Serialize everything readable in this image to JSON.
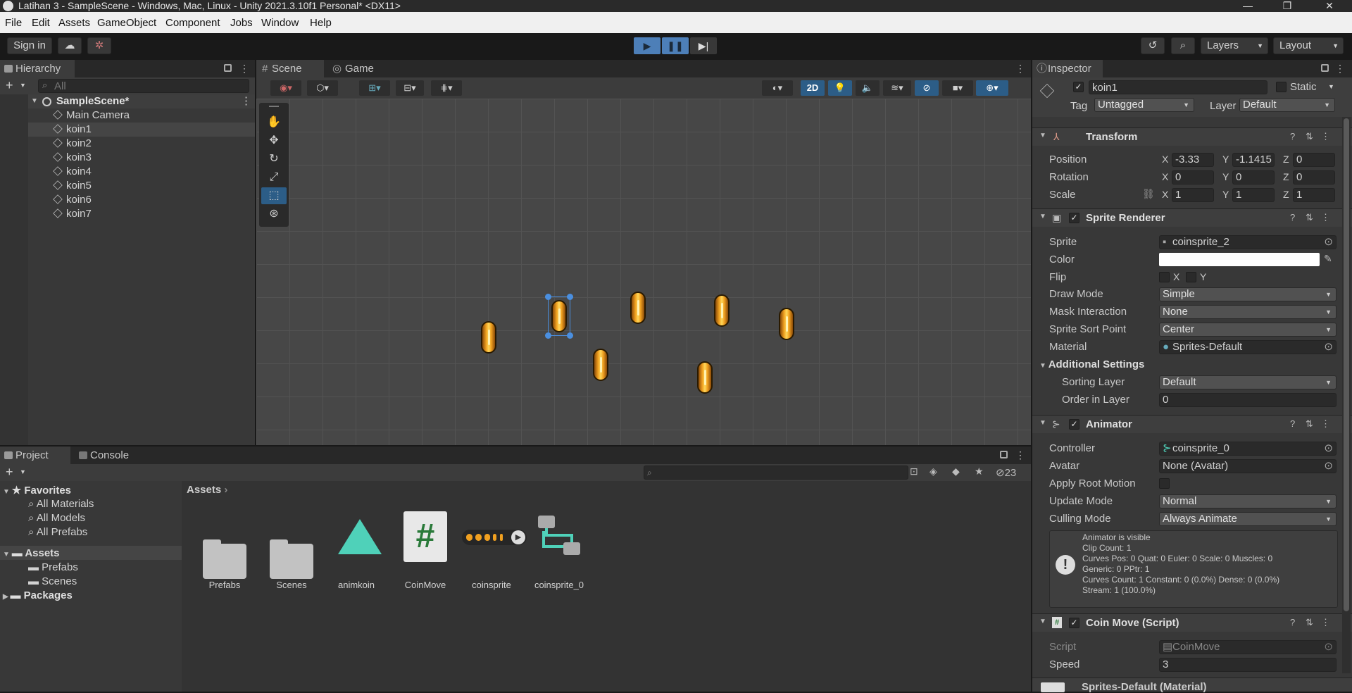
{
  "window": {
    "title": "Latihan 3 - SampleScene - Windows, Mac, Linux - Unity 2021.3.10f1 Personal* <DX11>",
    "controls": [
      "—",
      "❐",
      "✕"
    ]
  },
  "menu": [
    "File",
    "Edit",
    "Assets",
    "GameObject",
    "Component",
    "Jobs",
    "Window",
    "Help"
  ],
  "toolbar": {
    "sign_in": "Sign in",
    "layers": "Layers",
    "layout": "Layout"
  },
  "hierarchy": {
    "tab": "Hierarchy",
    "search_placeholder": "All",
    "scene": "SampleScene*",
    "items": [
      "Main Camera",
      "koin1",
      "koin2",
      "koin3",
      "koin4",
      "koin5",
      "koin6",
      "koin7"
    ],
    "selected": "koin1"
  },
  "scene_view": {
    "tabs": [
      "Scene",
      "Game"
    ],
    "mode_2d": "2D"
  },
  "project": {
    "tabs": [
      "Project",
      "Console"
    ],
    "favorites_label": "Favorites",
    "favorites": [
      "All Materials",
      "All Models",
      "All Prefabs"
    ],
    "assets_label": "Assets",
    "asset_folders": [
      "Prefabs",
      "Scenes"
    ],
    "packages_label": "Packages",
    "breadcrumb": "Assets",
    "hidden_count": "23",
    "assets": [
      "Prefabs",
      "Scenes",
      "animkoin",
      "CoinMove",
      "coinsprite",
      "coinsprite_0"
    ]
  },
  "inspector": {
    "tab": "Inspector",
    "object_name": "koin1",
    "static_label": "Static",
    "tag_label": "Tag",
    "tag_value": "Untagged",
    "layer_label": "Layer",
    "layer_value": "Default",
    "transform": {
      "title": "Transform",
      "position_label": "Position",
      "rotation_label": "Rotation",
      "scale_label": "Scale",
      "position": [
        "-3.33",
        "-1.1415",
        "0"
      ],
      "rotation": [
        "0",
        "0",
        "0"
      ],
      "scale": [
        "1",
        "1",
        "1"
      ]
    },
    "sprite_renderer": {
      "title": "Sprite Renderer",
      "sprite_label": "Sprite",
      "sprite": "coinsprite_2",
      "color_label": "Color",
      "flip_label": "Flip",
      "draw_mode_label": "Draw Mode",
      "draw_mode": "Simple",
      "mask_label": "Mask Interaction",
      "mask": "None",
      "sort_point_label": "Sprite Sort Point",
      "sort_point": "Center",
      "material_label": "Material",
      "material": "Sprites-Default",
      "additional_label": "Additional Settings",
      "sorting_layer_label": "Sorting Layer",
      "sorting_layer": "Default",
      "order_label": "Order in Layer",
      "order": "0"
    },
    "animator": {
      "title": "Animator",
      "controller_label": "Controller",
      "controller": "coinsprite_0",
      "avatar_label": "Avatar",
      "avatar": "None (Avatar)",
      "root_motion_label": "Apply Root Motion",
      "update_label": "Update Mode",
      "update": "Normal",
      "culling_label": "Culling Mode",
      "culling": "Always Animate",
      "info": [
        "Animator is visible",
        "Clip Count: 1",
        "Curves Pos: 0 Quat: 0 Euler: 0 Scale: 0 Muscles: 0",
        "Generic: 0 PPtr: 1",
        "Curves Count: 1 Constant: 0 (0.0%) Dense: 0 (0.0%)",
        "Stream: 1 (100.0%)"
      ]
    },
    "coin_move": {
      "title": "Coin Move (Script)",
      "script_label": "Script",
      "script": "CoinMove",
      "speed_label": "Speed",
      "speed": "3"
    },
    "material_footer": "Sprites-Default (Material)"
  },
  "colors": {
    "accent": "#3a72b0",
    "selection": "#2c5d87",
    "coin": "#f0a020",
    "script_icon": "#2a7a3a",
    "anim_icon": "#4fd1b9"
  }
}
